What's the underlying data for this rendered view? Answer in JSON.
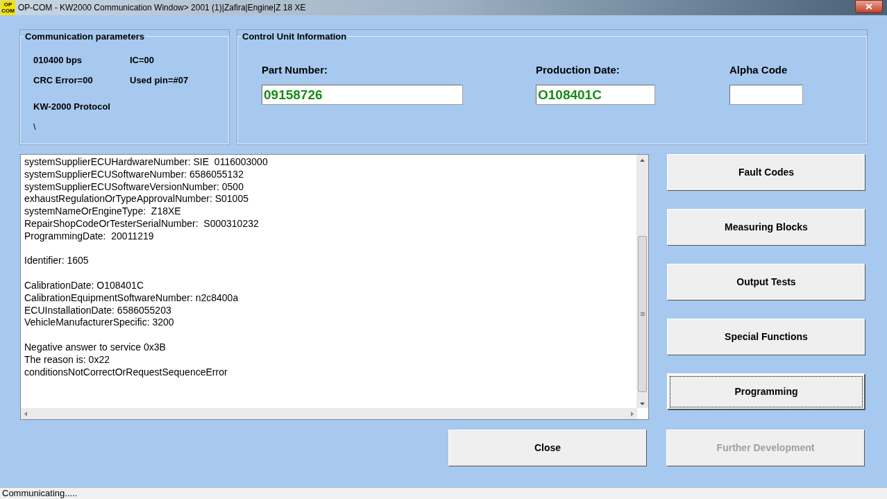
{
  "window": {
    "title": "OP-COM - KW2000 Communication Window> 2001 (1)|Zafira|Engine|Z 18 XE",
    "logo": "OP COM"
  },
  "communication_parameters": {
    "title": "Communication parameters",
    "items": [
      "010400 bps",
      "IC=00",
      "CRC Error=00",
      "Used pin=#07"
    ],
    "protocol": "KW-2000 Protocol",
    "extra": "\\"
  },
  "control_unit_information": {
    "title": "Control Unit Information",
    "fields": [
      {
        "label": "Part Number:",
        "value": "09158726"
      },
      {
        "label": "Production Date:",
        "value": "O108401C"
      },
      {
        "label": "Alpha Code"
      }
    ]
  },
  "log": [
    [
      "systemSupplierECUHardwareNumber: SIE  0116003000",
      "systemSupplierECUSoftwareNumber: 6586055132",
      "systemSupplierECUSoftwareVersionNumber: 0500",
      "exhaustRegulationOrTypeApprovalNumber: S01005",
      "systemNameOrEngineType:  Z18XE",
      "RepairShopCodeOrTesterSerialNumber:  S000310232",
      "ProgrammingDate:  20011219"
    ],
    [
      "Identifier: 1605"
    ],
    [
      "CalibrationDate: O108401C",
      "CalibrationEquipmentSoftwareNumber: n2c8400a",
      "ECUInstallationDate: 6586055203",
      "VehicleManufacturerSpecific: 3200"
    ],
    [
      "Negative answer to service 0x3B",
      "The reason is: 0x22",
      "conditionsNotCorrectOrRequestSequenceError"
    ]
  ],
  "side_buttons": [
    {
      "label": "Fault Codes",
      "focused": false,
      "disabled": false
    },
    {
      "label": "Measuring Blocks",
      "focused": false,
      "disabled": false
    },
    {
      "label": "Output Tests",
      "focused": false,
      "disabled": false
    },
    {
      "label": "Special Functions",
      "focused": false,
      "disabled": false
    },
    {
      "label": "Programming",
      "focused": true,
      "disabled": false
    }
  ],
  "bottom_buttons": [
    {
      "label": "Close",
      "focused": false,
      "disabled": false
    },
    {
      "label": "Further Development",
      "focused": false,
      "disabled": true
    }
  ],
  "status_bar": "Communicating....."
}
